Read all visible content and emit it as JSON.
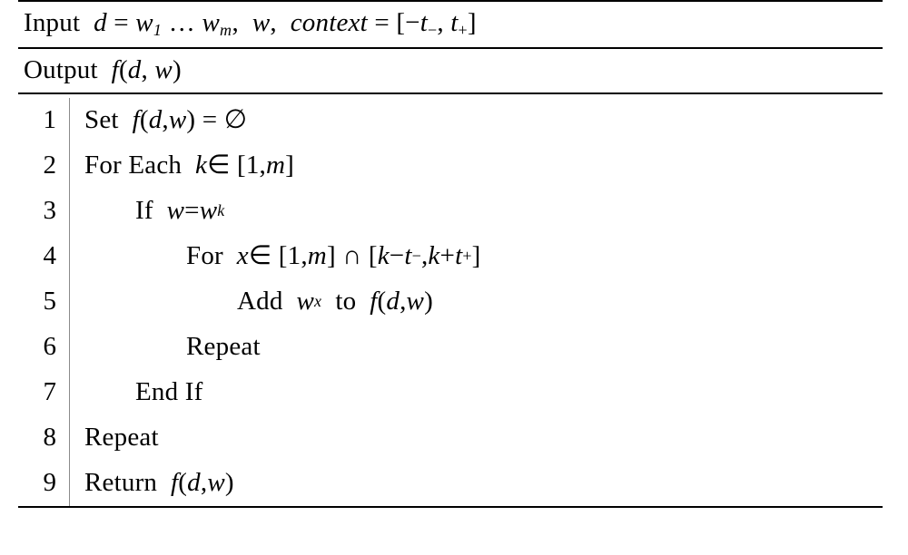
{
  "header": {
    "input_label": "Input",
    "input_expr_html": "&nbsp;<span class='i'>d</span> = <span class='i'>w</span><span class='sub'>1</span> … <span class='i'>w</span><span class='sub'>m</span>,&nbsp;&nbsp;<span class='i'>w</span>,&nbsp;&nbsp;<span class='i'>context</span> = [−<span class='i'>t</span><span class='subu'>−</span>, <span class='i'>t</span><span class='subu'>+</span>]",
    "output_label": "Output",
    "output_expr_html": "&nbsp;<span class='i'>f</span>(<span class='i'>d</span>, <span class='i'>w</span>)"
  },
  "lines": [
    {
      "n": "1",
      "indent": 0,
      "html": "Set &nbsp;<span class='i'>f</span>(<span class='i'>d</span>, <span class='i'>w</span>) = ∅"
    },
    {
      "n": "2",
      "indent": 0,
      "html": "For Each &nbsp;<span class='i'>k</span> ∈ [1, <span class='i'>m</span>]"
    },
    {
      "n": "3",
      "indent": 1,
      "html": "If &nbsp;<span class='i'>w</span> = <span class='i'>w</span><span class='sub'>k</span>"
    },
    {
      "n": "4",
      "indent": 2,
      "html": "For &nbsp;<span class='i'>x</span> ∈ [1, <span class='i'>m</span>] ∩ [<span class='i'>k</span> − <span class='i'>t</span><span class='subu'>−</span>, <span class='i'>k</span> + <span class='i'>t</span><span class='subu'>+</span>]"
    },
    {
      "n": "5",
      "indent": 3,
      "html": "Add &nbsp;<span class='i'>w</span><span class='sub'>x</span>&nbsp; to &nbsp;<span class='i'>f</span>(<span class='i'>d</span>, <span class='i'>w</span>)"
    },
    {
      "n": "6",
      "indent": 2,
      "html": "Repeat"
    },
    {
      "n": "7",
      "indent": 1,
      "html": "End If"
    },
    {
      "n": "8",
      "indent": 0,
      "html": "Repeat"
    },
    {
      "n": "9",
      "indent": 0,
      "html": "Return &nbsp;<span class='i'>f</span>(<span class='i'>d</span>, <span class='i'>w</span>)"
    }
  ]
}
